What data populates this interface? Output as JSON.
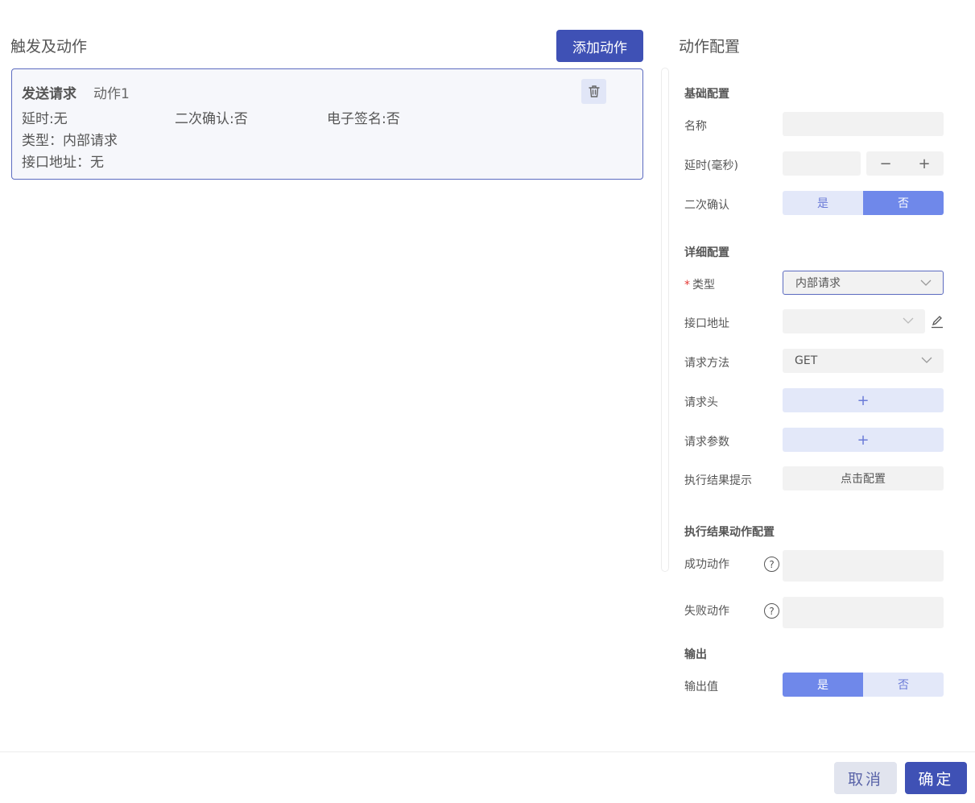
{
  "left": {
    "title": "触发及动作",
    "add_button": "添加动作",
    "action": {
      "type": "发送请求",
      "name": "动作1",
      "delay": "延时:无",
      "confirm": "二次确认:否",
      "esign": "电子签名:否",
      "kind": "类型：内部请求",
      "api": "接口地址：无",
      "delete_icon": "trash-icon"
    }
  },
  "right": {
    "title": "动作配置",
    "basic": {
      "section": "基础配置",
      "name_label": "名称",
      "name_value": "",
      "delay_label": "延时(毫秒)",
      "delay_value": "",
      "minus": "−",
      "plus": "+",
      "confirm_label": "二次确认",
      "confirm_yes": "是",
      "confirm_no": "否"
    },
    "detail": {
      "section": "详细配置",
      "required_mark": "*",
      "type_label": "类型",
      "type_value": "内部请求",
      "api_label": "接口地址",
      "api_value": "",
      "method_label": "请求方法",
      "method_value": "GET",
      "headers_label": "请求头",
      "headers_add": "+",
      "params_label": "请求参数",
      "params_add": "+",
      "result_label": "执行结果提示",
      "result_button": "点击配置"
    },
    "result_actions": {
      "section": "执行结果动作配置",
      "success_label": "成功动作",
      "fail_label": "失败动作",
      "help": "?"
    },
    "output": {
      "section": "输出",
      "value_label": "输出值",
      "yes": "是",
      "no": "否"
    }
  },
  "footer": {
    "cancel": "取消",
    "ok": "确定"
  },
  "colors": {
    "primary": "#3f51b5",
    "accent": "#6f88ea",
    "light": "#e3e8f9"
  }
}
